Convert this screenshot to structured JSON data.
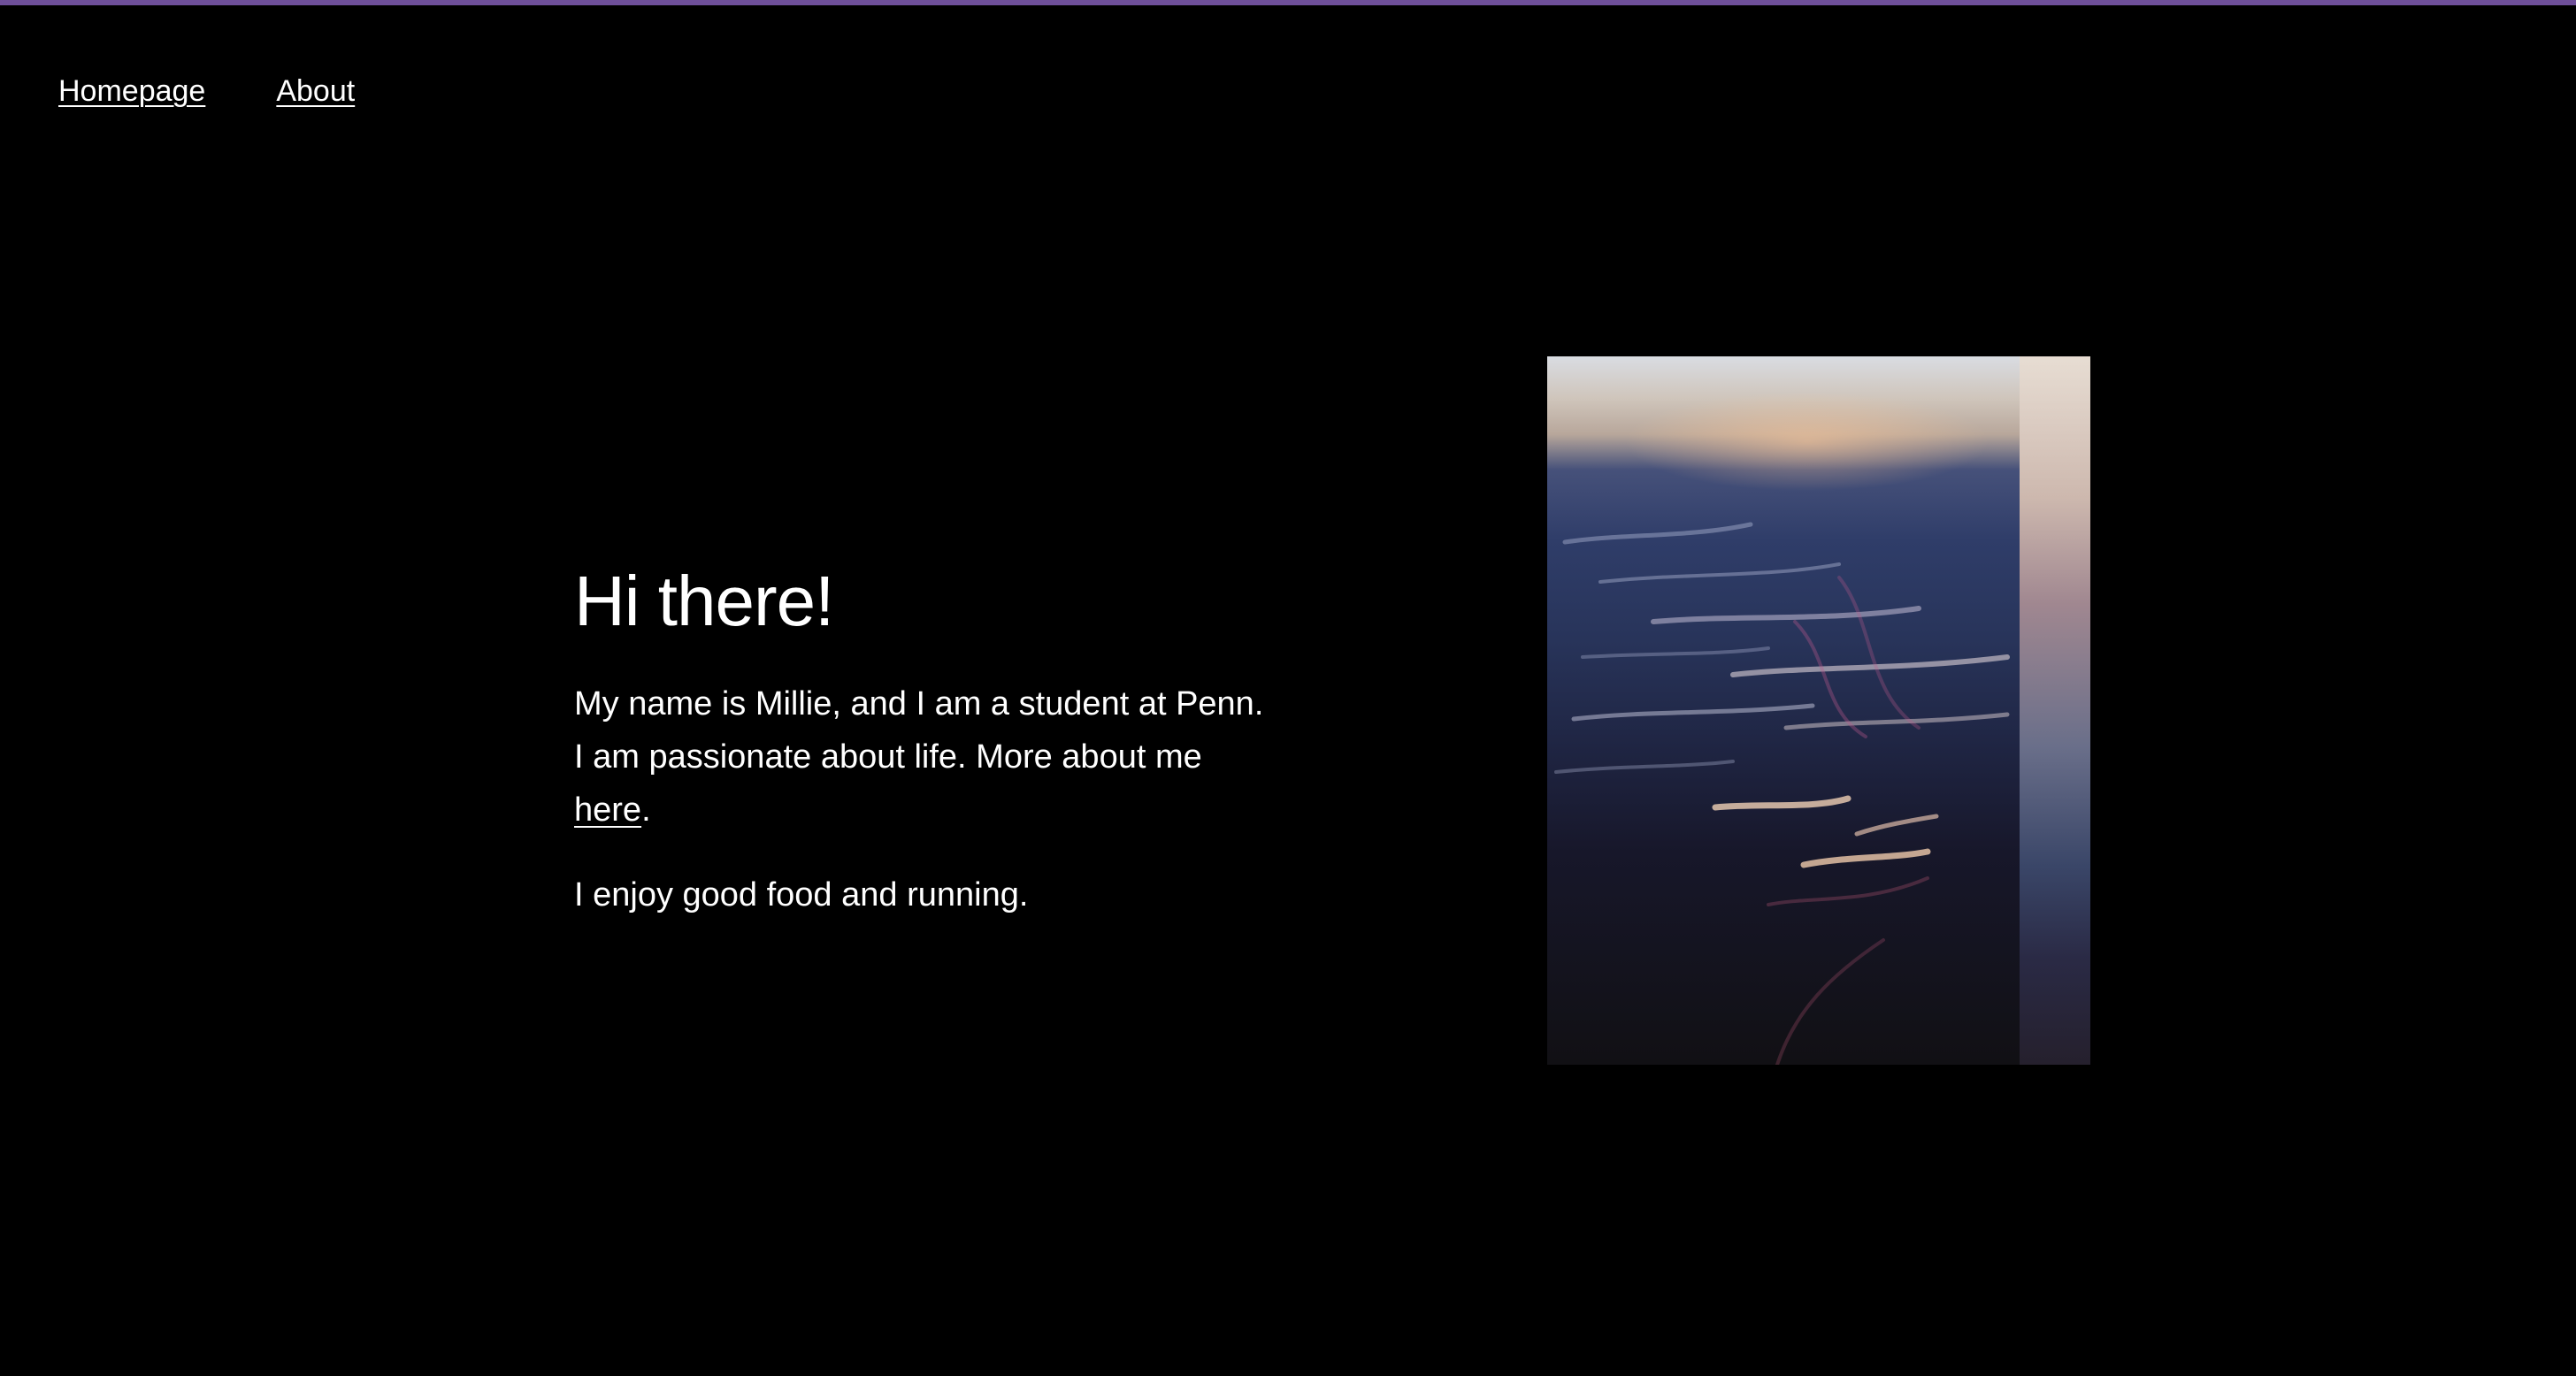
{
  "nav": {
    "items": [
      {
        "label": "Homepage"
      },
      {
        "label": "About"
      }
    ]
  },
  "hero": {
    "title": "Hi there!",
    "intro_before_link": "My name is Millie, and I am a student at Penn. I am passionate about life. More about me ",
    "intro_link": "here",
    "intro_after_link": ".",
    "hobbies": "I enjoy good food and running."
  },
  "colors": {
    "background": "#000000",
    "text": "#ffffff",
    "top_accent": "#6e4f99"
  }
}
